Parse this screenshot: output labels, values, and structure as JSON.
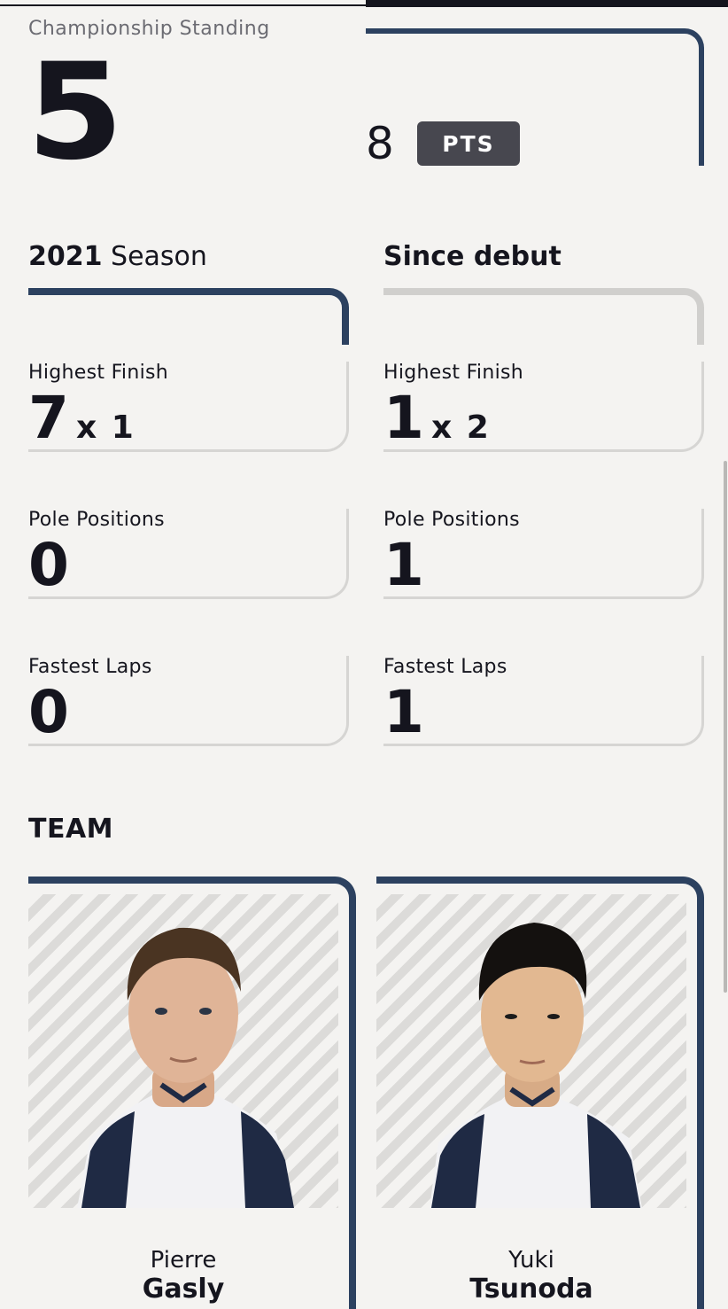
{
  "championship": {
    "label": "Championship Standing",
    "position": "5",
    "points": "8",
    "points_badge": "PTS"
  },
  "season": {
    "year": "2021",
    "label": "Season",
    "stats": [
      {
        "label": "Highest Finish",
        "value": "7",
        "multiplier": "x 1"
      },
      {
        "label": "Pole Positions",
        "value": "0",
        "multiplier": ""
      },
      {
        "label": "Fastest Laps",
        "value": "0",
        "multiplier": ""
      }
    ]
  },
  "career": {
    "label": "Since debut",
    "stats": [
      {
        "label": "Highest Finish",
        "value": "1",
        "multiplier": "x 2"
      },
      {
        "label": "Pole Positions",
        "value": "1",
        "multiplier": ""
      },
      {
        "label": "Fastest Laps",
        "value": "1",
        "multiplier": ""
      }
    ]
  },
  "team": {
    "title": "TEAM",
    "drivers": [
      {
        "first_name": "Pierre",
        "last_name": "Gasly"
      },
      {
        "first_name": "Yuki",
        "last_name": "Tsunoda"
      }
    ]
  },
  "colors": {
    "accent_navy": "#2c4160",
    "badge_grey": "#47474f",
    "card_border": "#d6d5d3"
  }
}
